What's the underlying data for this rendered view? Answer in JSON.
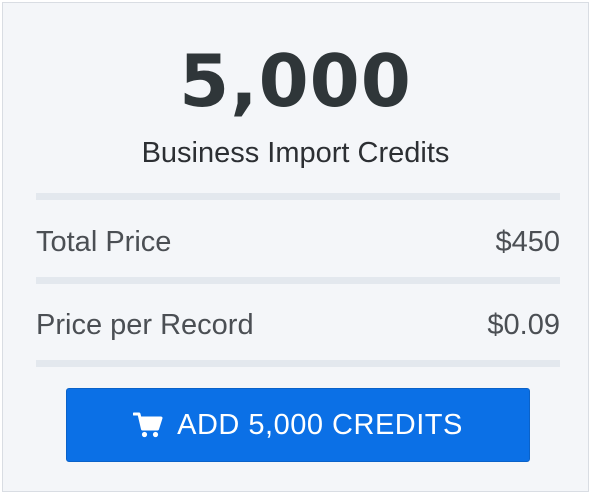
{
  "offer": {
    "credit_amount": "5,000",
    "credit_type": "Business Import Credits"
  },
  "pricing": {
    "rows": [
      {
        "label": "Total Price",
        "value": "$450"
      },
      {
        "label": "Price per Record",
        "value": "$0.09"
      }
    ]
  },
  "cta": {
    "label": "ADD 5,000 CREDITS",
    "icon": "shopping-cart-icon"
  },
  "colors": {
    "card_background": "#f4f6f9",
    "divider": "#e3e8ee",
    "heading_text": "#2f3639",
    "button_background": "#0b70e6",
    "button_text": "#ffffff"
  }
}
